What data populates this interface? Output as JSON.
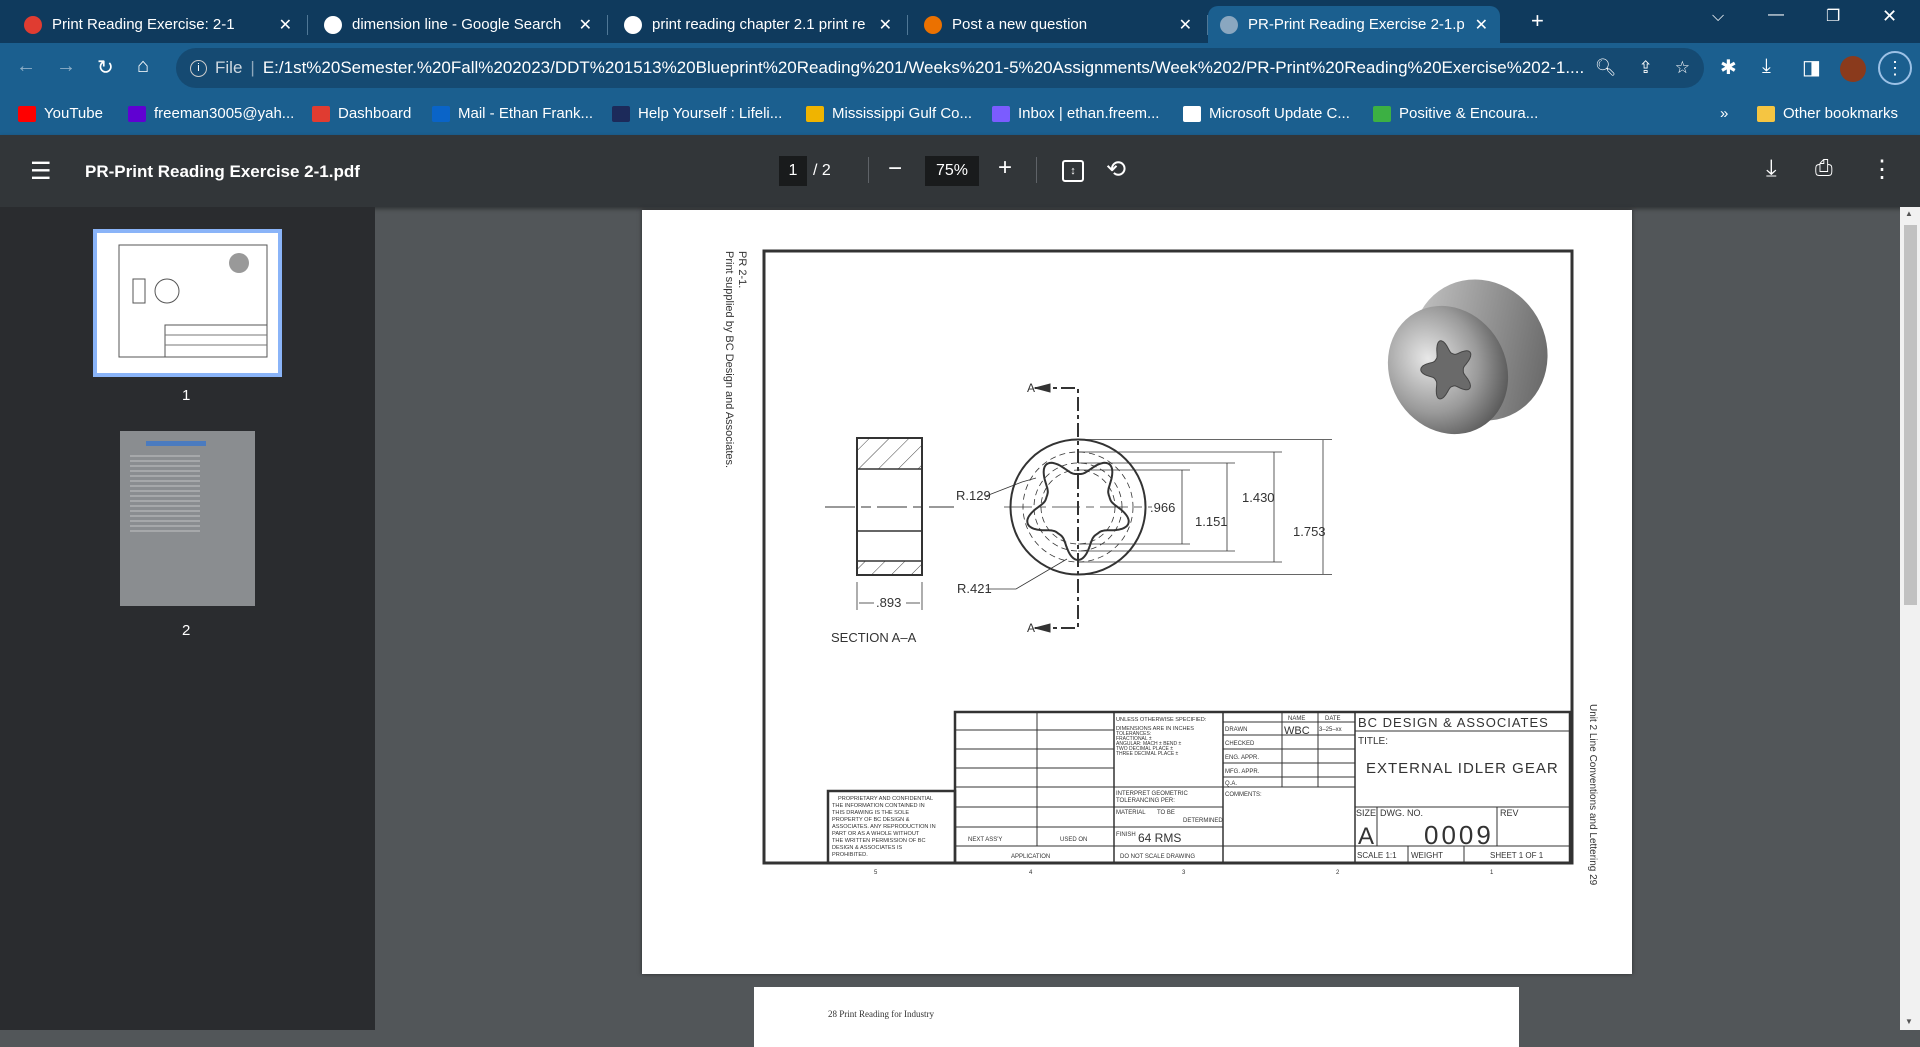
{
  "tabs": [
    {
      "title": "Print Reading Exercise: 2-1",
      "icon": "canvas-icon",
      "color": "#e03c31"
    },
    {
      "title": "dimension line - Google Search",
      "icon": "google-icon",
      "color": "#ffffff"
    },
    {
      "title": "print reading chapter 2.1 print re",
      "icon": "google-icon",
      "color": "#ffffff"
    },
    {
      "title": "Post a new question",
      "icon": "chegg-icon",
      "color": "#eb7100"
    },
    {
      "title": "PR-Print Reading Exercise 2-1.pdf",
      "icon": "globe-icon",
      "color": "#8aa7c0",
      "active": true
    }
  ],
  "address": {
    "scheme_label": "File",
    "url": "E:/1st%20Semester.%20Fall%202023/DDT%201513%20Blueprint%20Reading%201/Weeks%201-5%20Assignments/Week%202/PR-Print%20Reading%20Exercise%202-1...."
  },
  "bookmarks": [
    {
      "label": "YouTube",
      "color": "#ff0000"
    },
    {
      "label": "freeman3005@yah...",
      "color": "#6001d2"
    },
    {
      "label": "Dashboard",
      "color": "#e03c31"
    },
    {
      "label": "Mail - Ethan Frank...",
      "color": "#0a64c8"
    },
    {
      "label": "Help Yourself : Lifeli...",
      "color": "#1c2a5a"
    },
    {
      "label": "Mississippi Gulf Co...",
      "color": "#f0b400"
    },
    {
      "label": "Inbox | ethan.freem...",
      "color": "#7b5cff"
    },
    {
      "label": "Microsoft Update C...",
      "color": "#ffffff"
    },
    {
      "label": "Positive & Encoura...",
      "color": "#3cb043"
    }
  ],
  "bookmarks_more": "»",
  "other_bookmarks": "Other bookmarks",
  "pdf": {
    "filename": "PR-Print Reading Exercise 2-1.pdf",
    "page_current": "1",
    "page_total": "/ 2",
    "zoom": "75%"
  },
  "thumbnails": [
    {
      "label": "1",
      "selected": true
    },
    {
      "label": "2"
    }
  ],
  "accent": "#8ab4f8",
  "page": {
    "side_note_1": "PR 2-1.",
    "side_note_2": "Print supplied by BC Design and Associates.",
    "right_note": "Unit 2  Line Conventions and Lettering    29",
    "next_page_footer": "28   Print Reading for Industry"
  },
  "drawing": {
    "section_label": "SECTION A–A",
    "cut_label": "A",
    "dims": {
      "width": ".893",
      "r_small": "R.129",
      "r_large": "R.421",
      "d1": ".966",
      "d2": "1.151",
      "d3": "1.430",
      "d4": "1.753"
    },
    "zones": [
      "5",
      "4",
      "3",
      "2",
      "1"
    ],
    "proprietary": [
      "PROPRIETARY AND CONFIDENTIAL",
      "THE INFORMATION CONTAINED IN",
      "THIS DRAWING IS THE SOLE",
      "PROPERTY OF BC DESIGN &",
      "ASSOCIATES. ANY REPRODUCTION IN",
      "PART OR AS A WHOLE WITHOUT",
      "THE WRITTEN PERMISSION OF BC",
      "DESIGN & ASSOCIATES IS",
      "PROHIBITED."
    ],
    "title_block": {
      "next_assy": "NEXT ASS'Y",
      "used_on": "USED ON",
      "application": "APPLICATION",
      "notes": [
        "UNLESS OTHERWISE SPECIFIED:",
        "DIMENSIONS ARE IN INCHES",
        "TOLERANCES:",
        "FRACTIONAL ±",
        "ANGULAR: MACH ±    BEND ±",
        "TWO DECIMAL PLACE ±",
        "THREE DECIMAL PLACE ±"
      ],
      "interpret": [
        "INTERPRET GEOMETRIC",
        "TOLERANCING PER:"
      ],
      "material_label": "MATERIAL",
      "material": [
        "TO BE",
        "DETERMINED"
      ],
      "finish_label": "FINISH",
      "finish": "64 RMS",
      "do_not_scale": "DO NOT SCALE DRAWING",
      "name_header": "NAME",
      "date_header": "DATE",
      "rows": [
        "DRAWN",
        "CHECKED",
        "ENG. APPR.",
        "MFG. APPR.",
        "Q.A."
      ],
      "drawn_name": "WBC",
      "drawn_date": "3–25–xx",
      "comments": "COMMENTS:",
      "company": "BC DESIGN & ASSOCIATES",
      "title_label": "TITLE:",
      "title": "EXTERNAL IDLER GEAR",
      "size_label": "SIZE",
      "size": "A",
      "dwg_label": "DWG. NO.",
      "dwg_no": "0009",
      "rev_label": "REV",
      "scale": "SCALE 1:1",
      "weight": "WEIGHT",
      "sheet": "SHEET 1 OF 1"
    }
  }
}
